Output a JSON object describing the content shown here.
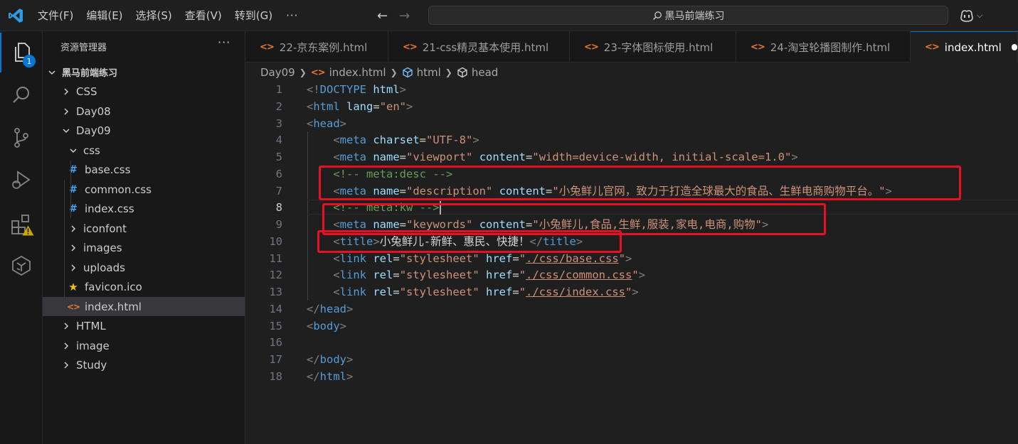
{
  "titlebar": {
    "menu": [
      "文件(F)",
      "编辑(E)",
      "选择(S)",
      "查看(V)",
      "转到(G)"
    ],
    "more": "···",
    "search_text": "黑马前端练习"
  },
  "activity": {
    "explorer_badge": "1",
    "items": [
      "explorer-icon",
      "search-icon",
      "source-control-icon",
      "run-debug-icon",
      "extensions-icon",
      "remote-icon"
    ]
  },
  "sidebar": {
    "title": "资源管理器",
    "more": "···",
    "tree": [
      {
        "label": "黑马前端练习",
        "type": "root",
        "icon": "chevron-down"
      },
      {
        "label": "CSS",
        "type": "folder",
        "icon": "chevron-right"
      },
      {
        "label": "Day08",
        "type": "folder",
        "icon": "chevron-right"
      },
      {
        "label": "Day09",
        "type": "folder",
        "icon": "chevron-down"
      },
      {
        "label": "css",
        "type": "folder",
        "icon": "chevron-down"
      },
      {
        "label": "base.css",
        "type": "file-css"
      },
      {
        "label": "common.css",
        "type": "file-css"
      },
      {
        "label": "index.css",
        "type": "file-css"
      },
      {
        "label": "iconfont",
        "type": "folder",
        "icon": "chevron-right"
      },
      {
        "label": "images",
        "type": "folder",
        "icon": "chevron-right"
      },
      {
        "label": "uploads",
        "type": "folder",
        "icon": "chevron-right"
      },
      {
        "label": "favicon.ico",
        "type": "file-ico"
      },
      {
        "label": "index.html",
        "type": "file-html",
        "selected": true
      },
      {
        "label": "HTML",
        "type": "folder",
        "icon": "chevron-right"
      },
      {
        "label": "image",
        "type": "folder",
        "icon": "chevron-right"
      },
      {
        "label": "Study",
        "type": "folder",
        "icon": "chevron-right"
      }
    ]
  },
  "tabs": [
    {
      "label": "22-京东案例.html",
      "active": false
    },
    {
      "label": "21-css精灵基本使用.html",
      "active": false
    },
    {
      "label": "23-字体图标使用.html",
      "active": false
    },
    {
      "label": "24-淘宝轮播图制作.html",
      "active": false
    },
    {
      "label": "index.html",
      "active": true,
      "dirty": true
    }
  ],
  "breadcrumb": [
    "Day09",
    "index.html",
    "html",
    "head"
  ],
  "editor": {
    "current_line": 8,
    "lines": [
      {
        "n": "1",
        "tokens": [
          [
            "p",
            "<!"
          ],
          [
            "tag",
            "DOCTYPE"
          ],
          [
            "text",
            " "
          ],
          [
            "attr",
            "html"
          ],
          [
            "p",
            ">"
          ]
        ]
      },
      {
        "n": "2",
        "tokens": [
          [
            "p",
            "<"
          ],
          [
            "tag",
            "html"
          ],
          [
            "text",
            " "
          ],
          [
            "attr",
            "lang"
          ],
          [
            "eq",
            "="
          ],
          [
            "str",
            "\"en\""
          ],
          [
            "p",
            ">"
          ]
        ]
      },
      {
        "n": "3",
        "tokens": [
          [
            "p",
            "<"
          ],
          [
            "tag",
            "head"
          ],
          [
            "p",
            ">"
          ]
        ]
      },
      {
        "n": "4",
        "tokens": [
          [
            "text",
            "    "
          ],
          [
            "p",
            "<"
          ],
          [
            "tag",
            "meta"
          ],
          [
            "text",
            " "
          ],
          [
            "attr",
            "charset"
          ],
          [
            "eq",
            "="
          ],
          [
            "str",
            "\"UTF-8\""
          ],
          [
            "p",
            ">"
          ]
        ]
      },
      {
        "n": "5",
        "tokens": [
          [
            "text",
            "    "
          ],
          [
            "p",
            "<"
          ],
          [
            "tag",
            "meta"
          ],
          [
            "text",
            " "
          ],
          [
            "attr",
            "name"
          ],
          [
            "eq",
            "="
          ],
          [
            "str",
            "\"viewport\""
          ],
          [
            "text",
            " "
          ],
          [
            "attr",
            "content"
          ],
          [
            "eq",
            "="
          ],
          [
            "str",
            "\"width=device-width, initial-scale=1.0\""
          ],
          [
            "p",
            ">"
          ]
        ]
      },
      {
        "n": "6",
        "tokens": [
          [
            "text",
            "    "
          ],
          [
            "comment",
            "<!-- meta:desc -->"
          ]
        ]
      },
      {
        "n": "7",
        "tokens": [
          [
            "text",
            "    "
          ],
          [
            "p",
            "<"
          ],
          [
            "tag",
            "meta"
          ],
          [
            "text",
            " "
          ],
          [
            "attr",
            "name"
          ],
          [
            "eq",
            "="
          ],
          [
            "str",
            "\"description\""
          ],
          [
            "text",
            " "
          ],
          [
            "attr",
            "content"
          ],
          [
            "eq",
            "="
          ],
          [
            "str",
            "\"小兔鲜儿官网，致力于打造全球最大的食品、生鲜电商购物平台。\""
          ],
          [
            "p",
            ">"
          ]
        ]
      },
      {
        "n": "8",
        "tokens": [
          [
            "text",
            "    "
          ],
          [
            "comment",
            "<!-- meta:kw -->"
          ]
        ]
      },
      {
        "n": "9",
        "tokens": [
          [
            "text",
            "    "
          ],
          [
            "p",
            "<"
          ],
          [
            "tag",
            "meta"
          ],
          [
            "text",
            " "
          ],
          [
            "attr",
            "name"
          ],
          [
            "eq",
            "="
          ],
          [
            "str",
            "\"keywords\""
          ],
          [
            "text",
            " "
          ],
          [
            "attr",
            "content"
          ],
          [
            "eq",
            "="
          ],
          [
            "str",
            "\"小兔鲜儿,食品,生鲜,服装,家电,电商,购物\""
          ],
          [
            "p",
            ">"
          ]
        ]
      },
      {
        "n": "10",
        "tokens": [
          [
            "text",
            "    "
          ],
          [
            "p",
            "<"
          ],
          [
            "tag",
            "title"
          ],
          [
            "p",
            ">"
          ],
          [
            "text",
            "小兔鲜儿-新鲜、惠民、快捷！"
          ],
          [
            "p",
            "</"
          ],
          [
            "tag",
            "title"
          ],
          [
            "p",
            ">"
          ]
        ]
      },
      {
        "n": "11",
        "tokens": [
          [
            "text",
            "    "
          ],
          [
            "p",
            "<"
          ],
          [
            "tag",
            "link"
          ],
          [
            "text",
            " "
          ],
          [
            "attr",
            "rel"
          ],
          [
            "eq",
            "="
          ],
          [
            "str",
            "\"stylesheet\""
          ],
          [
            "text",
            " "
          ],
          [
            "attr",
            "href"
          ],
          [
            "eq",
            "="
          ],
          [
            "str",
            "\""
          ],
          [
            "link",
            "./css/base.css"
          ],
          [
            "str",
            "\""
          ],
          [
            "p",
            ">"
          ]
        ]
      },
      {
        "n": "12",
        "tokens": [
          [
            "text",
            "    "
          ],
          [
            "p",
            "<"
          ],
          [
            "tag",
            "link"
          ],
          [
            "text",
            " "
          ],
          [
            "attr",
            "rel"
          ],
          [
            "eq",
            "="
          ],
          [
            "str",
            "\"stylesheet\""
          ],
          [
            "text",
            " "
          ],
          [
            "attr",
            "href"
          ],
          [
            "eq",
            "="
          ],
          [
            "str",
            "\""
          ],
          [
            "link",
            "./css/common.css"
          ],
          [
            "str",
            "\""
          ],
          [
            "p",
            ">"
          ]
        ]
      },
      {
        "n": "13",
        "tokens": [
          [
            "text",
            "    "
          ],
          [
            "p",
            "<"
          ],
          [
            "tag",
            "link"
          ],
          [
            "text",
            " "
          ],
          [
            "attr",
            "rel"
          ],
          [
            "eq",
            "="
          ],
          [
            "str",
            "\"stylesheet\""
          ],
          [
            "text",
            " "
          ],
          [
            "attr",
            "href"
          ],
          [
            "eq",
            "="
          ],
          [
            "str",
            "\""
          ],
          [
            "link",
            "./css/index.css"
          ],
          [
            "str",
            "\""
          ],
          [
            "p",
            ">"
          ]
        ]
      },
      {
        "n": "14",
        "tokens": [
          [
            "p",
            "</"
          ],
          [
            "tag",
            "head"
          ],
          [
            "p",
            ">"
          ]
        ]
      },
      {
        "n": "15",
        "tokens": [
          [
            "p",
            "<"
          ],
          [
            "tag",
            "body"
          ],
          [
            "p",
            ">"
          ]
        ]
      },
      {
        "n": "16",
        "tokens": []
      },
      {
        "n": "17",
        "tokens": [
          [
            "p",
            "</"
          ],
          [
            "tag",
            "body"
          ],
          [
            "p",
            ">"
          ]
        ]
      },
      {
        "n": "18",
        "tokens": [
          [
            "p",
            "</"
          ],
          [
            "tag",
            "html"
          ],
          [
            "p",
            ">"
          ]
        ]
      }
    ]
  },
  "colors": {
    "accent": "#0078d4",
    "annotation": "#e81123",
    "background": "#1f1f1f"
  }
}
